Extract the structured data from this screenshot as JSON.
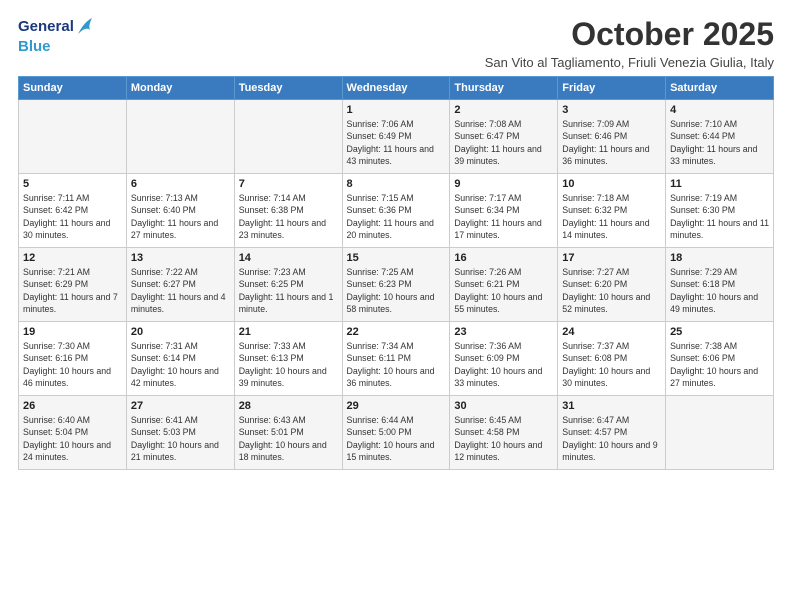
{
  "logo": {
    "line1": "General",
    "line2": "Blue"
  },
  "header": {
    "title": "October 2025",
    "subtitle": "San Vito al Tagliamento, Friuli Venezia Giulia, Italy"
  },
  "weekdays": [
    "Sunday",
    "Monday",
    "Tuesday",
    "Wednesday",
    "Thursday",
    "Friday",
    "Saturday"
  ],
  "weeks": [
    [
      {
        "day": "",
        "sunrise": "",
        "sunset": "",
        "daylight": ""
      },
      {
        "day": "",
        "sunrise": "",
        "sunset": "",
        "daylight": ""
      },
      {
        "day": "",
        "sunrise": "",
        "sunset": "",
        "daylight": ""
      },
      {
        "day": "1",
        "sunrise": "Sunrise: 7:06 AM",
        "sunset": "Sunset: 6:49 PM",
        "daylight": "Daylight: 11 hours and 43 minutes."
      },
      {
        "day": "2",
        "sunrise": "Sunrise: 7:08 AM",
        "sunset": "Sunset: 6:47 PM",
        "daylight": "Daylight: 11 hours and 39 minutes."
      },
      {
        "day": "3",
        "sunrise": "Sunrise: 7:09 AM",
        "sunset": "Sunset: 6:46 PM",
        "daylight": "Daylight: 11 hours and 36 minutes."
      },
      {
        "day": "4",
        "sunrise": "Sunrise: 7:10 AM",
        "sunset": "Sunset: 6:44 PM",
        "daylight": "Daylight: 11 hours and 33 minutes."
      }
    ],
    [
      {
        "day": "5",
        "sunrise": "Sunrise: 7:11 AM",
        "sunset": "Sunset: 6:42 PM",
        "daylight": "Daylight: 11 hours and 30 minutes."
      },
      {
        "day": "6",
        "sunrise": "Sunrise: 7:13 AM",
        "sunset": "Sunset: 6:40 PM",
        "daylight": "Daylight: 11 hours and 27 minutes."
      },
      {
        "day": "7",
        "sunrise": "Sunrise: 7:14 AM",
        "sunset": "Sunset: 6:38 PM",
        "daylight": "Daylight: 11 hours and 23 minutes."
      },
      {
        "day": "8",
        "sunrise": "Sunrise: 7:15 AM",
        "sunset": "Sunset: 6:36 PM",
        "daylight": "Daylight: 11 hours and 20 minutes."
      },
      {
        "day": "9",
        "sunrise": "Sunrise: 7:17 AM",
        "sunset": "Sunset: 6:34 PM",
        "daylight": "Daylight: 11 hours and 17 minutes."
      },
      {
        "day": "10",
        "sunrise": "Sunrise: 7:18 AM",
        "sunset": "Sunset: 6:32 PM",
        "daylight": "Daylight: 11 hours and 14 minutes."
      },
      {
        "day": "11",
        "sunrise": "Sunrise: 7:19 AM",
        "sunset": "Sunset: 6:30 PM",
        "daylight": "Daylight: 11 hours and 11 minutes."
      }
    ],
    [
      {
        "day": "12",
        "sunrise": "Sunrise: 7:21 AM",
        "sunset": "Sunset: 6:29 PM",
        "daylight": "Daylight: 11 hours and 7 minutes."
      },
      {
        "day": "13",
        "sunrise": "Sunrise: 7:22 AM",
        "sunset": "Sunset: 6:27 PM",
        "daylight": "Daylight: 11 hours and 4 minutes."
      },
      {
        "day": "14",
        "sunrise": "Sunrise: 7:23 AM",
        "sunset": "Sunset: 6:25 PM",
        "daylight": "Daylight: 11 hours and 1 minute."
      },
      {
        "day": "15",
        "sunrise": "Sunrise: 7:25 AM",
        "sunset": "Sunset: 6:23 PM",
        "daylight": "Daylight: 10 hours and 58 minutes."
      },
      {
        "day": "16",
        "sunrise": "Sunrise: 7:26 AM",
        "sunset": "Sunset: 6:21 PM",
        "daylight": "Daylight: 10 hours and 55 minutes."
      },
      {
        "day": "17",
        "sunrise": "Sunrise: 7:27 AM",
        "sunset": "Sunset: 6:20 PM",
        "daylight": "Daylight: 10 hours and 52 minutes."
      },
      {
        "day": "18",
        "sunrise": "Sunrise: 7:29 AM",
        "sunset": "Sunset: 6:18 PM",
        "daylight": "Daylight: 10 hours and 49 minutes."
      }
    ],
    [
      {
        "day": "19",
        "sunrise": "Sunrise: 7:30 AM",
        "sunset": "Sunset: 6:16 PM",
        "daylight": "Daylight: 10 hours and 46 minutes."
      },
      {
        "day": "20",
        "sunrise": "Sunrise: 7:31 AM",
        "sunset": "Sunset: 6:14 PM",
        "daylight": "Daylight: 10 hours and 42 minutes."
      },
      {
        "day": "21",
        "sunrise": "Sunrise: 7:33 AM",
        "sunset": "Sunset: 6:13 PM",
        "daylight": "Daylight: 10 hours and 39 minutes."
      },
      {
        "day": "22",
        "sunrise": "Sunrise: 7:34 AM",
        "sunset": "Sunset: 6:11 PM",
        "daylight": "Daylight: 10 hours and 36 minutes."
      },
      {
        "day": "23",
        "sunrise": "Sunrise: 7:36 AM",
        "sunset": "Sunset: 6:09 PM",
        "daylight": "Daylight: 10 hours and 33 minutes."
      },
      {
        "day": "24",
        "sunrise": "Sunrise: 7:37 AM",
        "sunset": "Sunset: 6:08 PM",
        "daylight": "Daylight: 10 hours and 30 minutes."
      },
      {
        "day": "25",
        "sunrise": "Sunrise: 7:38 AM",
        "sunset": "Sunset: 6:06 PM",
        "daylight": "Daylight: 10 hours and 27 minutes."
      }
    ],
    [
      {
        "day": "26",
        "sunrise": "Sunrise: 6:40 AM",
        "sunset": "Sunset: 5:04 PM",
        "daylight": "Daylight: 10 hours and 24 minutes."
      },
      {
        "day": "27",
        "sunrise": "Sunrise: 6:41 AM",
        "sunset": "Sunset: 5:03 PM",
        "daylight": "Daylight: 10 hours and 21 minutes."
      },
      {
        "day": "28",
        "sunrise": "Sunrise: 6:43 AM",
        "sunset": "Sunset: 5:01 PM",
        "daylight": "Daylight: 10 hours and 18 minutes."
      },
      {
        "day": "29",
        "sunrise": "Sunrise: 6:44 AM",
        "sunset": "Sunset: 5:00 PM",
        "daylight": "Daylight: 10 hours and 15 minutes."
      },
      {
        "day": "30",
        "sunrise": "Sunrise: 6:45 AM",
        "sunset": "Sunset: 4:58 PM",
        "daylight": "Daylight: 10 hours and 12 minutes."
      },
      {
        "day": "31",
        "sunrise": "Sunrise: 6:47 AM",
        "sunset": "Sunset: 4:57 PM",
        "daylight": "Daylight: 10 hours and 9 minutes."
      },
      {
        "day": "",
        "sunrise": "",
        "sunset": "",
        "daylight": ""
      }
    ]
  ]
}
